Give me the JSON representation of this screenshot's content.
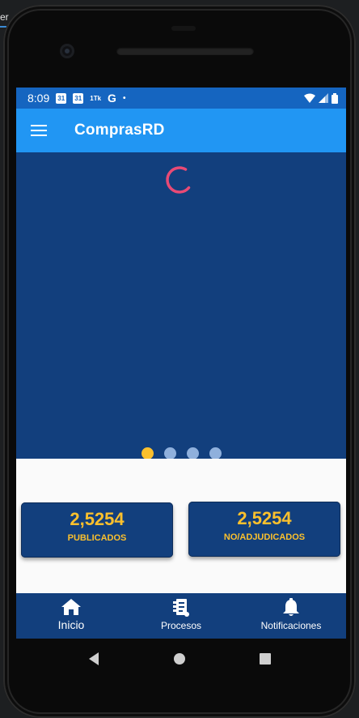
{
  "status_bar": {
    "time": "8:09",
    "icons": [
      "calendar-31-icon",
      "calendar-31-icon",
      "data-saver-icon",
      "google-icon",
      "dot-icon",
      "wifi-icon",
      "signal-icon",
      "battery-icon"
    ],
    "calendar_day": "31",
    "google_letter": "G",
    "misc_text": "1Tk"
  },
  "app_bar": {
    "title": "ComprasRD"
  },
  "carousel": {
    "state": "loading",
    "page_count": 4,
    "active_page": 1
  },
  "stats": [
    {
      "value": "2,5254",
      "label": "PUBLICADOS"
    },
    {
      "value": "2,5254",
      "label": "NO/ADJUDICADOS"
    }
  ],
  "bottom_nav": {
    "items": [
      {
        "label": "Inicio",
        "icon": "home-icon",
        "active": true
      },
      {
        "label": "Procesos",
        "icon": "document-list-icon",
        "active": false
      },
      {
        "label": "Notificaciones",
        "icon": "bell-icon",
        "active": false
      }
    ]
  },
  "colors": {
    "status_bar": "#1565c0",
    "app_bar": "#2196f3",
    "primary_dark": "#123f7d",
    "accent": "#fbc02d",
    "spinner": "#e84a75",
    "inactive_dot": "#8fb0dc"
  },
  "emulator_side_text": "er"
}
